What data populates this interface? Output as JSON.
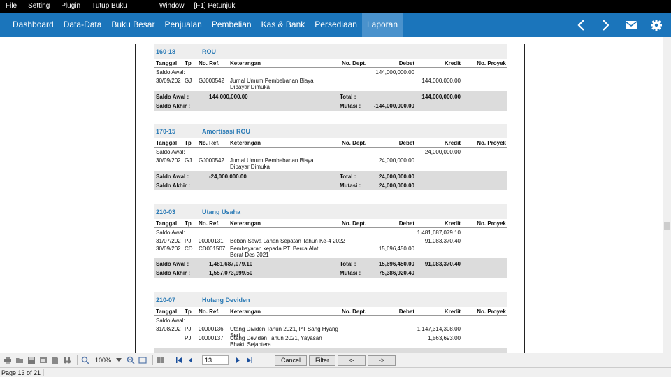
{
  "menubar": {
    "items": [
      "File",
      "Setting",
      "Plugin",
      "Tutup Buku",
      "Window",
      "[F1] Petunjuk"
    ]
  },
  "navbar": {
    "items": [
      "Dashboard",
      "Data-Data",
      "Buku Besar",
      "Penjualan",
      "Pembelian",
      "Kas & Bank",
      "Persediaan",
      "Laporan"
    ],
    "active": "Laporan",
    "icons": [
      "chevron-left-icon",
      "chevron-right-icon",
      "mail-icon",
      "gear-icon"
    ],
    "colors": {
      "bar": "#1b75bb",
      "active": "#4a92cc"
    }
  },
  "columns": {
    "tanggal": "Tanggal",
    "tp": "Tp",
    "ref": "No. Ref.",
    "ket": "Keterangan",
    "dept": "No. Dept.",
    "debet": "Debet",
    "kredit": "Kredit",
    "proyek": "No. Proyek"
  },
  "labels": {
    "saldo_awal_row": "Saldo Awal:",
    "saldo_awal": "Saldo Awal :",
    "saldo_akhir": "Saldo Akhir :",
    "total": "Total :",
    "mutasi": "Mutasi :"
  },
  "accounts": [
    {
      "code": "160-18",
      "name": "ROU",
      "saldo_awal_debet": "144,000,000.00",
      "saldo_awal_kredit": "",
      "rows": [
        {
          "tgl": "30/09/202",
          "tp": "GJ",
          "ref": "GJ000542",
          "ket": "Jurnal Umum Pembebanan Biaya Dibayar Dimuka",
          "debet": "",
          "kredit": "144,000,000.00"
        }
      ],
      "sum_saldo_awal": "144,000,000.00",
      "sum_saldo_akhir": "",
      "total_debet": "",
      "total_kredit": "144,000,000.00",
      "mutasi": "-144,000,000.00"
    },
    {
      "code": "170-15",
      "name": "Amortisasi ROU",
      "saldo_awal_debet": "",
      "saldo_awal_kredit": "24,000,000.00",
      "rows": [
        {
          "tgl": "30/09/202",
          "tp": "GJ",
          "ref": "GJ000542",
          "ket": "Jurnal Umum Pembebanan Biaya Dibayar Dimuka",
          "debet": "24,000,000.00",
          "kredit": ""
        }
      ],
      "sum_saldo_awal": "-24,000,000.00",
      "sum_saldo_akhir": "",
      "total_debet": "24,000,000.00",
      "total_kredit": "",
      "mutasi": "24,000,000.00"
    },
    {
      "code": "210-03",
      "name": "Utang Usaha",
      "saldo_awal_debet": "",
      "saldo_awal_kredit": "1,481,687,079.10",
      "rows": [
        {
          "tgl": "31/07/202",
          "tp": "PJ",
          "ref": "00000131",
          "ket": "Beban Sewa Lahan Sepatan Tahun Ke-4 2022",
          "debet": "",
          "kredit": "91,083,370.40"
        },
        {
          "tgl": "30/09/202",
          "tp": "CD",
          "ref": "CD001507",
          "ket": "Pembayaran kepada PT. Berca Alat Berat Des 2021",
          "debet": "15,696,450.00",
          "kredit": ""
        }
      ],
      "sum_saldo_awal": "1,481,687,079.10",
      "sum_saldo_akhir": "1,557,073,999.50",
      "total_debet": "15,696,450.00",
      "total_kredit": "91,083,370.40",
      "mutasi": "75,386,920.40"
    },
    {
      "code": "210-07",
      "name": "Hutang Deviden",
      "saldo_awal_debet": "",
      "saldo_awal_kredit": "",
      "rows": [
        {
          "tgl": "31/08/202",
          "tp": "PJ",
          "ref": "00000136",
          "ket": "Utang Dividen Tahun 2021, PT Sang Hyang Seri",
          "debet": "",
          "kredit": "1,147,314,308.00"
        },
        {
          "tgl": "",
          "tp": "PJ",
          "ref": "00000137",
          "ket": "Utang Deviden Tahun 2021, Yayasan Bhakti Sejahtera",
          "debet": "",
          "kredit": "1,563,693.00"
        }
      ]
    }
  ],
  "toolbar": {
    "zoom": "100%",
    "page_input": "13",
    "buttons": [
      "Cancel",
      "Filter",
      "<-",
      "->"
    ]
  },
  "status": {
    "page": "Page 13 of 21"
  }
}
